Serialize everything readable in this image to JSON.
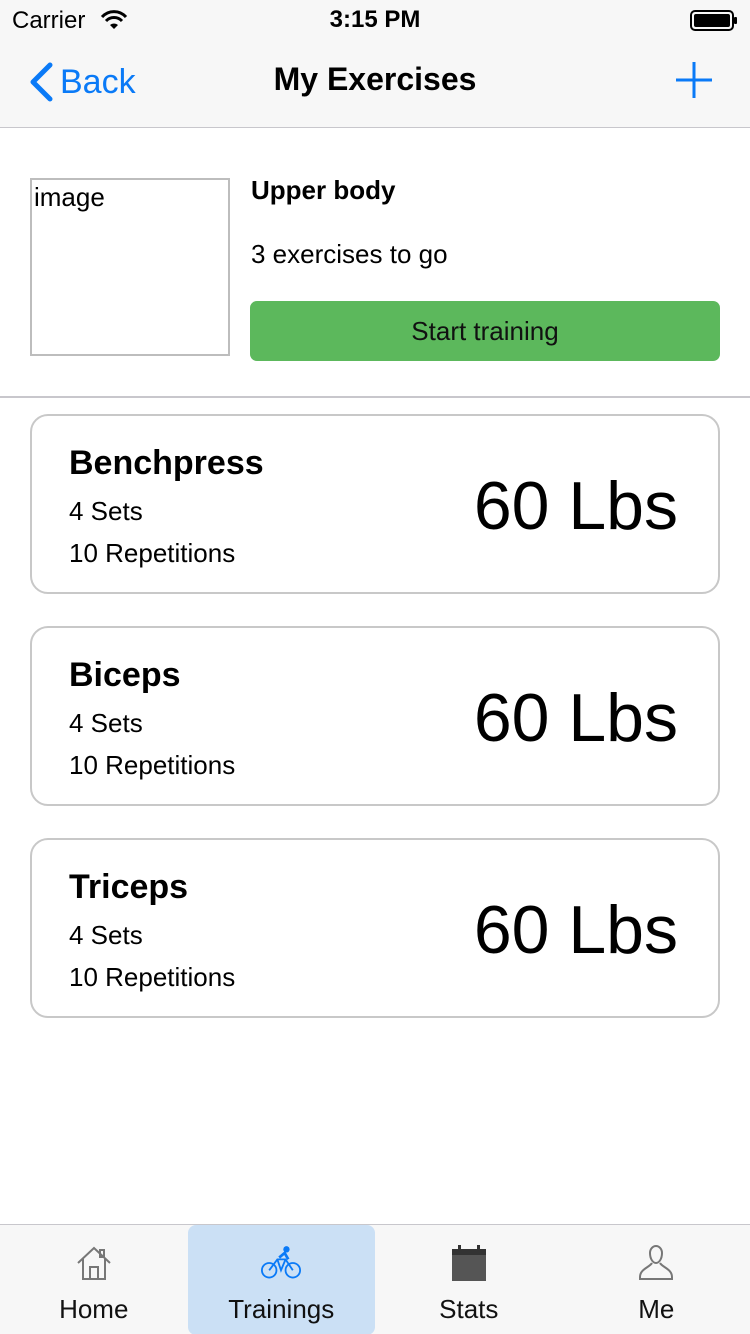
{
  "status_bar": {
    "carrier": "Carrier",
    "time": "3:15 PM"
  },
  "nav": {
    "back_label": "Back",
    "title": "My Exercises",
    "add_icon": "plus-icon"
  },
  "header": {
    "image_placeholder": "image",
    "title": "Upper body",
    "subtitle": "3 exercises to go",
    "start_button": "Start training"
  },
  "exercises": [
    {
      "name": "Benchpress",
      "sets": "4 Sets",
      "reps": "10 Repetitions",
      "weight": "60 Lbs"
    },
    {
      "name": "Biceps",
      "sets": "4 Sets",
      "reps": "10 Repetitions",
      "weight": "60 Lbs"
    },
    {
      "name": "Triceps",
      "sets": "4 Sets",
      "reps": "10 Repetitions",
      "weight": "60 Lbs"
    }
  ],
  "tab_bar": {
    "items": [
      {
        "label": "Home",
        "icon": "home-icon"
      },
      {
        "label": "Trainings",
        "icon": "bicycle-icon",
        "active": true
      },
      {
        "label": "Stats",
        "icon": "calendar-icon"
      },
      {
        "label": "Me",
        "icon": "person-icon"
      }
    ]
  },
  "colors": {
    "accent": "#0a7af7",
    "start_button": "#5cb85c",
    "active_tab_bg": "#cbe0f5"
  }
}
